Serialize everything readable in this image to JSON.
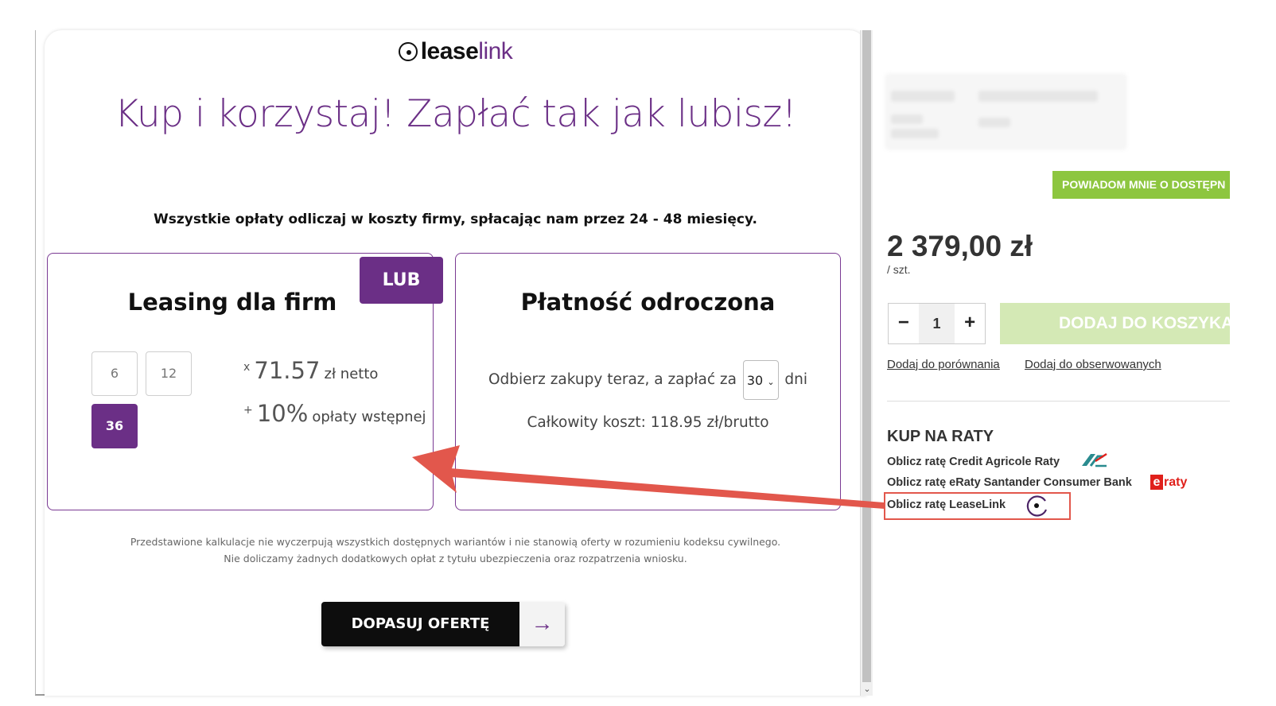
{
  "modal": {
    "logo": {
      "bold": "lease",
      "light": "link"
    },
    "headline": "Kup i korzystaj! Zapłać tak jak lubisz!",
    "subline": "Wszystkie opłaty odliczaj w koszty firmy, spłacając nam przez 24 - 48 miesięcy.",
    "lub_badge": "LUB",
    "leasing": {
      "title": "Leasing dla firm",
      "terms": [
        "6",
        "12",
        "36"
      ],
      "selected_term": "36",
      "rate_prefix": "x",
      "rate_value": "71.57",
      "rate_unit": "zł netto",
      "fee_prefix": "+",
      "fee_value": "10%",
      "fee_unit": "opłaty wstępnej"
    },
    "deferred": {
      "title": "Płatność odroczona",
      "text_before": "Odbierz zakupy teraz, a zapłać za",
      "days_value": "30",
      "text_after": "dni",
      "total_cost": "Całkowity koszt: 118.95 zł/brutto"
    },
    "disclaimer_line1": "Przedstawione kalkulacje nie wyczerpują wszystkich dostępnych wariantów i nie stanowią oferty w rozumieniu kodeksu cywilnego.",
    "disclaimer_line2": "Nie doliczamy żadnych dodatkowych opłat z tytułu ubezpieczenia oraz rozpatrzenia wniosku.",
    "cta_label": "DOPASUJ OFERTĘ",
    "cta_arrow": "→"
  },
  "product": {
    "notify_button": "POWIADOM MNIE O DOSTĘPN",
    "price": "2 379,00 zł",
    "price_unit": "/ szt.",
    "quantity": "1",
    "qty_minus": "−",
    "qty_plus": "+",
    "add_to_cart": "DODAJ DO KOSZYKA",
    "link_compare": "Dodaj do porównania",
    "link_watch": "Dodaj do obserwowanych",
    "installments_heading": "KUP NA RATY",
    "installments": {
      "credit_agricole": "Oblicz ratę Credit Agricole Raty",
      "santander": "Oblicz ratę eRaty Santander Consumer Bank",
      "leaselink": "Oblicz ratę LeaseLink"
    },
    "eraty_logo": {
      "e": "e",
      "rest": "raty"
    }
  },
  "colors": {
    "brand_purple": "#6b2f86",
    "annotation_red": "#e2574c",
    "notify_green": "#8dc63f",
    "cart_green_disabled": "#d4e9b5"
  },
  "icons": [
    "leaselink-logo-icon",
    "arrow-right-icon",
    "chevron-down-icon",
    "credit-agricole-logo-icon",
    "eraty-logo-icon"
  ]
}
